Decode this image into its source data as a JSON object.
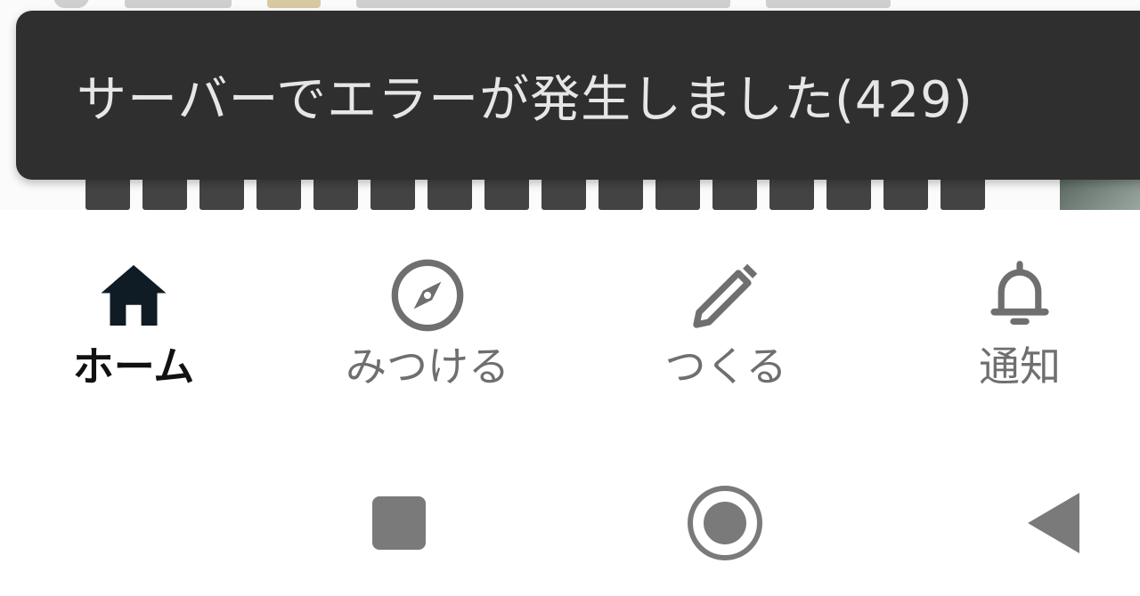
{
  "snackbar": {
    "message": "サーバーでエラーが発生しました(429)"
  },
  "bottom_nav": {
    "items": [
      {
        "label": "ホーム",
        "icon": "home-icon",
        "active": true
      },
      {
        "label": "みつける",
        "icon": "compass-icon",
        "active": false
      },
      {
        "label": "つくる",
        "icon": "pencil-icon",
        "active": false
      },
      {
        "label": "通知",
        "icon": "bell-icon",
        "active": false
      }
    ]
  },
  "system_nav": {
    "buttons": [
      {
        "icon": "recents-square-icon"
      },
      {
        "icon": "home-circle-icon"
      },
      {
        "icon": "back-triangle-icon"
      }
    ]
  },
  "colors": {
    "snackbar_bg": "#2f2f2f",
    "snackbar_text": "#e6e6e6",
    "nav_active": "#111111",
    "nav_inactive": "#6f6f6f",
    "system_icon": "#7a7a7a"
  }
}
